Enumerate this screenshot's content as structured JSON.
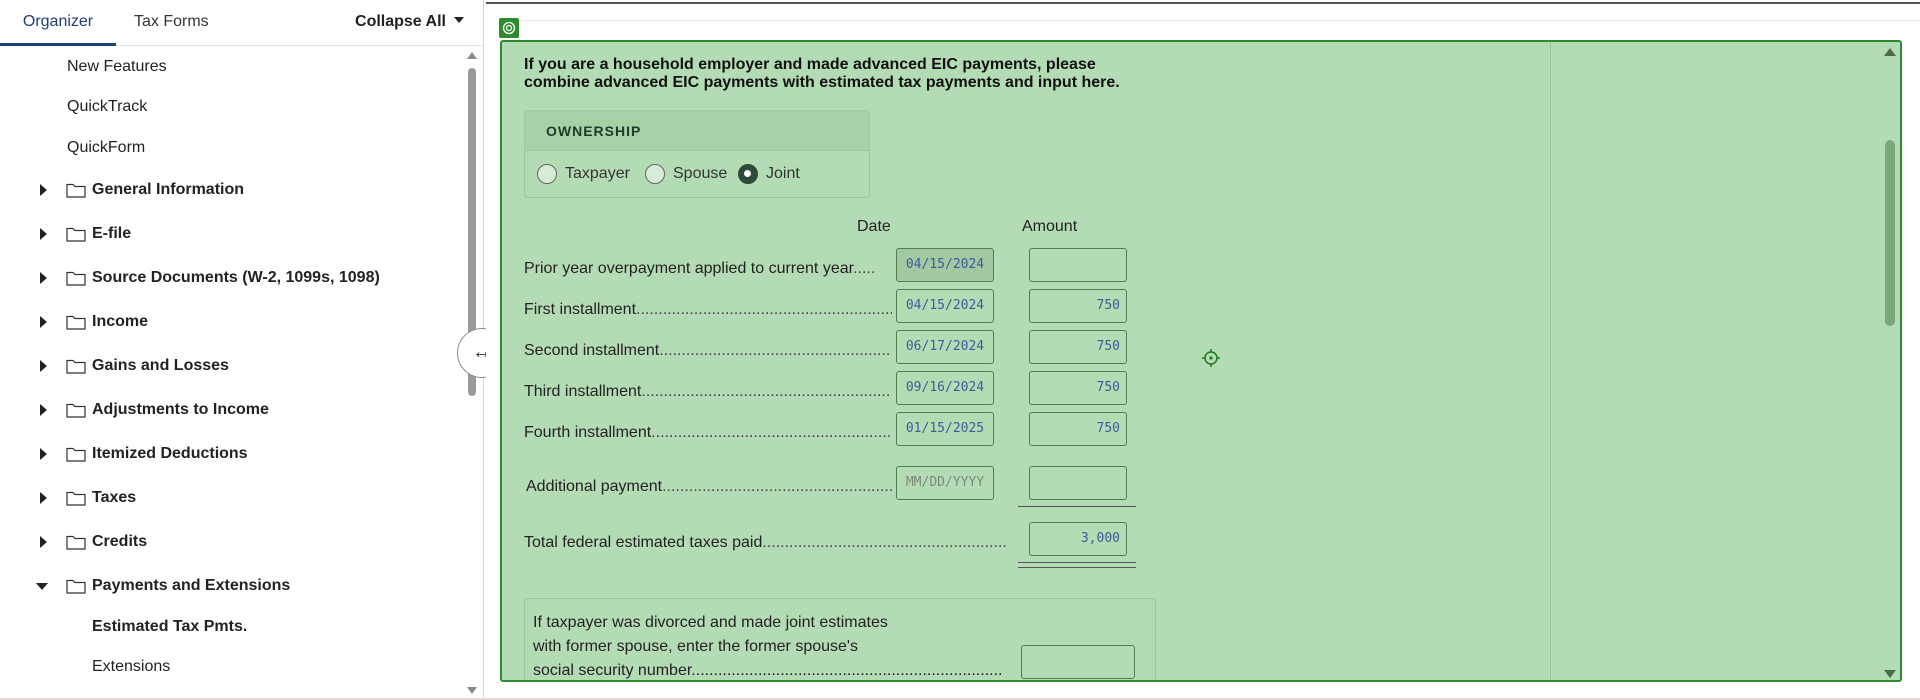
{
  "organizer": {
    "tabs": [
      {
        "label": "Organizer",
        "active": true
      },
      {
        "label": "Tax Forms",
        "active": false
      }
    ],
    "collapse_all": "Collapse All",
    "items_plain": [
      "New Features",
      "QuickTrack",
      "QuickForm"
    ],
    "folders": [
      {
        "label": "General Information",
        "expanded": false
      },
      {
        "label": "E-file",
        "expanded": false
      },
      {
        "label": "Source Documents (W-2, 1099s, 1098)",
        "expanded": false
      },
      {
        "label": "Income",
        "expanded": false
      },
      {
        "label": "Gains and Losses",
        "expanded": false
      },
      {
        "label": "Adjustments to Income",
        "expanded": false
      },
      {
        "label": "Itemized Deductions",
        "expanded": false
      },
      {
        "label": "Taxes",
        "expanded": false
      },
      {
        "label": "Credits",
        "expanded": false
      },
      {
        "label": "Payments and Extensions",
        "expanded": true
      }
    ],
    "children": [
      {
        "label": "Estimated Tax Pmts.",
        "selected": true
      },
      {
        "label": "Extensions",
        "selected": false
      }
    ]
  },
  "form": {
    "note": "If you are a household employer and made advanced EIC payments, please combine advanced EIC payments with estimated tax payments and input here.",
    "ownership": {
      "header": "OWNERSHIP",
      "options": [
        "Taxpayer",
        "Spouse",
        "Joint"
      ],
      "selected": "Joint"
    },
    "columns": {
      "date": "Date",
      "amount": "Amount"
    },
    "rows": [
      {
        "label": "Prior year overpayment applied to current year",
        "dots": ".....",
        "date": "04/15/2024",
        "amount": ""
      },
      {
        "label": "First installment",
        "dots": "...................................................................",
        "date": "04/15/2024",
        "amount": "750"
      },
      {
        "label": "Second installment",
        "dots": ".................................................................",
        "date": "06/17/2024",
        "amount": "750"
      },
      {
        "label": "Third installment",
        "dots": "..................................................................",
        "date": "09/16/2024",
        "amount": "750"
      },
      {
        "label": "Fourth installment",
        "dots": "................................................................",
        "date": "01/15/2025",
        "amount": "750"
      }
    ],
    "additional": {
      "label": "Additional payment",
      "dots": ".................................................................",
      "date_placeholder": "MM/DD/YYYY",
      "amount": ""
    },
    "total": {
      "label": "Total federal estimated taxes paid",
      "dots": "............................................................................",
      "amount": "3,000"
    },
    "former_spouse": {
      "line1": "If taxpayer was divorced and made joint estimates",
      "line2": "with former spouse, enter the former spouse's",
      "line3": "social security number",
      "dots": "......................................................................",
      "value": ""
    }
  },
  "icons": {
    "splitter": "↔",
    "pin": "target-pin-icon",
    "crosshair": "crosshair-icon"
  },
  "colors": {
    "form_bg": "#b4dcb4",
    "form_border": "#2e8b2e",
    "accent": "#1d3d7a"
  }
}
